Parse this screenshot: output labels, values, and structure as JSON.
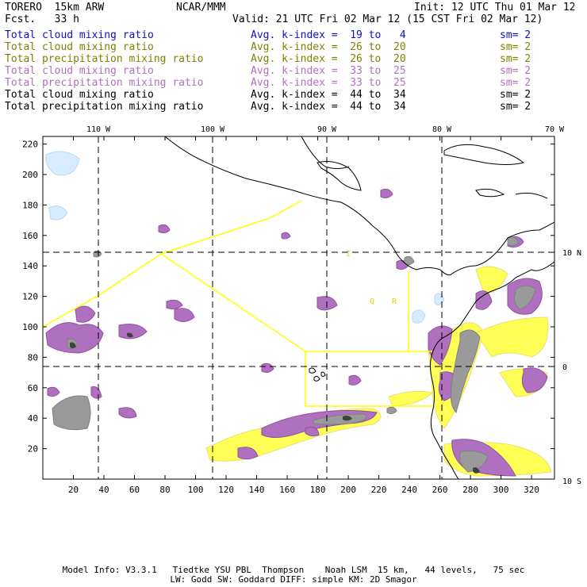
{
  "header": {
    "model": "TORERO  15km ARW",
    "org": "NCAR/MMM",
    "init": "Init: 12 UTC Thu 01 Mar 12",
    "fcst": "Fcst.   33 h",
    "valid": "Valid: 21 UTC Fri 02 Mar 12 (15 CST Fri 02 Mar 12)"
  },
  "legend": [
    {
      "field": "Total cloud mixing ratio",
      "kindex": "Avg. k-index =  19 to   4",
      "sm": "sm= 2",
      "color": "#1010c0"
    },
    {
      "field": "Total cloud mixing ratio",
      "kindex": "Avg. k-index =  26 to  20",
      "sm": "sm= 2",
      "color": "#808000"
    },
    {
      "field": "Total precipitation mixing ratio",
      "kindex": "Avg. k-index =  26 to  20",
      "sm": "sm= 2",
      "color": "#808000"
    },
    {
      "field": "Total cloud mixing ratio",
      "kindex": "Avg. k-index =  33 to  25",
      "sm": "sm= 2",
      "color": "#b070c0"
    },
    {
      "field": "Total precipitation mixing ratio",
      "kindex": "Avg. k-index =  33 to  25",
      "sm": "sm= 2",
      "color": "#b070c0"
    },
    {
      "field": "Total cloud mixing ratio",
      "kindex": "Avg. k-index =  44 to  34",
      "sm": "sm= 2",
      "color": "#000000"
    },
    {
      "field": "Total precipitation mixing ratio",
      "kindex": "Avg. k-index =  44 to  34",
      "sm": "sm= 2",
      "color": "#000000"
    }
  ],
  "map": {
    "lon_labels": [
      "110 W",
      "100 W",
      "90 W",
      "80 W",
      "70 W"
    ],
    "lat_labels": [
      "10 N",
      "0",
      "10 S"
    ],
    "x_ticks": [
      "20",
      "40",
      "60",
      "80",
      "100",
      "120",
      "140",
      "160",
      "180",
      "200",
      "220",
      "240",
      "260",
      "280",
      "300",
      "320"
    ],
    "y_ticks": [
      "20",
      "40",
      "60",
      "80",
      "100",
      "120",
      "140",
      "160",
      "180",
      "200",
      "220"
    ],
    "x_range": [
      0,
      335
    ],
    "y_range": [
      0,
      225
    ],
    "annotations": [
      "I",
      "Q",
      "R"
    ]
  },
  "footer": {
    "line1": "Model Info: V3.3.1   Tiedtke YSU PBL  Thompson    Noah LSM  15 km,   44 levels,   75 sec",
    "line2": "LW: Godd SW: Goddard DIFF: simple KM: 2D Smagor"
  }
}
